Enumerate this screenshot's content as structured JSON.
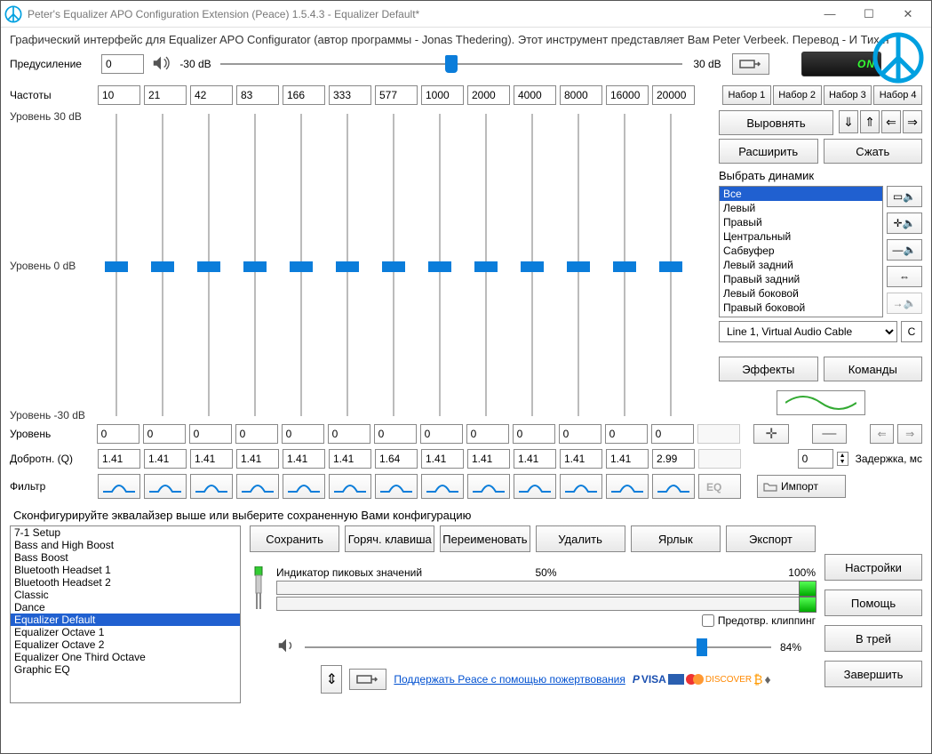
{
  "window": {
    "title": "Peter's Equalizer APO Configuration Extension (Peace) 1.5.4.3 - Equalizer Default*"
  },
  "description": "Графический интерфейс для Equalizer APO Configurator (автор программы - Jonas Thedering). Этот инструмент представляет Вам Peter Verbeek. Перевод - И Тих н",
  "preamp": {
    "label": "Предусиление",
    "value": "0",
    "min_label": "-30 dB",
    "max_label": "30 dB",
    "on_label": "ON"
  },
  "freq": {
    "label": "Частоты",
    "values": [
      "10",
      "21",
      "42",
      "83",
      "166",
      "333",
      "577",
      "1000",
      "2000",
      "4000",
      "8000",
      "16000",
      "20000"
    ]
  },
  "sliders_y": {
    "top": "Уровень 30 dB",
    "mid": "Уровень 0 dB",
    "bot": "Уровень -30 dB"
  },
  "sets": {
    "items": [
      "Набор 1",
      "Набор 2",
      "Набор 3",
      "Набор 4"
    ]
  },
  "right": {
    "align": "Выровнять",
    "expand": "Расширить",
    "compress": "Сжать",
    "speaker_label": "Выбрать динамик",
    "speakers": [
      "Все",
      "Левый",
      "Правый",
      "Центральный",
      "Сабвуфер",
      "Левый задний",
      "Правый задний",
      "Левый боковой",
      "Правый боковой"
    ],
    "device": "Line 1, Virtual Audio Cable",
    "c": "С",
    "effects": "Эффекты",
    "commands": "Команды"
  },
  "level": {
    "label": "Уровень",
    "values": [
      "0",
      "0",
      "0",
      "0",
      "0",
      "0",
      "0",
      "0",
      "0",
      "0",
      "0",
      "0",
      "0"
    ]
  },
  "quality": {
    "label": "Добротн. (Q)",
    "values": [
      "1.41",
      "1.41",
      "1.41",
      "1.41",
      "1.41",
      "1.41",
      "1.64",
      "1.41",
      "1.41",
      "1.41",
      "1.41",
      "1.41",
      "2.99"
    ],
    "delay_value": "0",
    "delay_label": "Задержка, мс"
  },
  "filter": {
    "label": "Фильтр",
    "import": "Импорт"
  },
  "config_label": "Сконфигурируйте эквалайзер выше или выберите сохраненную Вами конфигурацию",
  "presets": {
    "items": [
      "7-1 Setup",
      "Bass and High Boost",
      "Bass Boost",
      "Bluetooth Headset 1",
      "Bluetooth Headset 2",
      "Classic",
      "Dance",
      "Equalizer Default",
      "Equalizer Octave 1",
      "Equalizer Octave 2",
      "Equalizer One Third Octave",
      "Graphic EQ"
    ],
    "selected": "Equalizer Default"
  },
  "preset_btns": {
    "save": "Сохранить",
    "hotkey": "Горяч. клавиша",
    "rename": "Переименовать",
    "delete": "Удалить",
    "shortcut": "Ярлык",
    "export": "Экспорт"
  },
  "meters": {
    "peak_label": "Индикатор пиковых значений",
    "mid_pct": "50%",
    "full_pct": "100%",
    "clipping": "Предотвр. клиппинг",
    "vol_pct": "84%"
  },
  "rbtns": {
    "settings": "Настройки",
    "help": "Помощь",
    "tray": "В трей",
    "quit": "Завершить"
  },
  "donate": {
    "text": "Поддержать Peace с помощью пожертвования"
  }
}
